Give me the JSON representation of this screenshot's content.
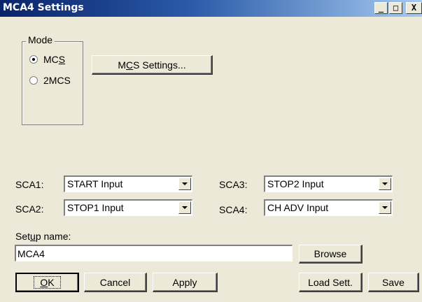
{
  "window": {
    "title": "MCA4 Settings",
    "controls": {
      "minimize": "_",
      "maximize": "□",
      "close": "X"
    }
  },
  "mode": {
    "label": "Mode",
    "options": [
      {
        "pre": "MC",
        "accel": "S",
        "post": "",
        "checked": true
      },
      {
        "pre": "2MCS",
        "accel": "",
        "post": "",
        "checked": false
      }
    ]
  },
  "mcs_settings_button": {
    "pre": "M",
    "accel": "C",
    "post": "S Settings..."
  },
  "sca": [
    {
      "label": "SCA1:",
      "value": "START Input"
    },
    {
      "label": "SCA2:",
      "value": "STOP1 Input"
    },
    {
      "label": "SCA3:",
      "value": "STOP2 Input"
    },
    {
      "label": "SCA4:",
      "value": "CH ADV Input"
    }
  ],
  "setup": {
    "label_pre": "Set",
    "label_accel": "u",
    "label_post": "p name:",
    "value": "MCA4"
  },
  "buttons": {
    "browse": "Browse",
    "ok_accel": "O",
    "ok_post": "K",
    "cancel": "Cancel",
    "apply": "Apply",
    "load": "Load Sett.",
    "save": "Save"
  }
}
